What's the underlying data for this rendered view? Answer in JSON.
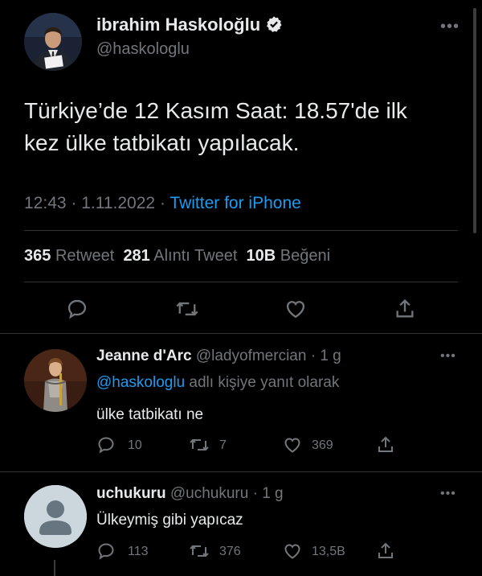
{
  "main_tweet": {
    "author_name": "ibrahim Haskoloğlu",
    "author_handle": "@haskologlu",
    "text_line1": "Türkiye’de 12 Kasım Saat: 18.57'de ilk",
    "text_line2": "kez ülke tatbikatı yapılacak.",
    "time": "12:43",
    "date": "1.11.2022",
    "source": "Twitter for iPhone",
    "stats": {
      "retweets_count": "365",
      "retweets_label": "Retweet",
      "quotes_count": "281",
      "quotes_label": "Alıntı Tweet",
      "likes_count": "10B",
      "likes_label": "Beğeni"
    },
    "icons": [
      "reply-icon",
      "retweet-icon",
      "like-icon",
      "share-icon"
    ]
  },
  "replies": [
    {
      "author_name": "Jeanne d'Arc",
      "author_handle": "@ladyofmercian",
      "age": "1 g",
      "reply_to_handle": "@haskologlu",
      "reply_to_suffix": "adlı kişiye yanıt olarak",
      "text": "ülke tatbikatı ne",
      "reply_count": "10",
      "retweet_count": "7",
      "like_count": "369"
    },
    {
      "author_name": "uchukuru",
      "author_handle": "@uchukuru",
      "age": "1 g",
      "text": "Ülkeymiş gibi yapıcaz",
      "reply_count": "113",
      "retweet_count": "376",
      "like_count": "13,5B"
    }
  ],
  "colors": {
    "background": "#000000",
    "text": "#e7e9ea",
    "muted": "#71767b",
    "link": "#1d9bf0",
    "divider": "#2f3336"
  }
}
